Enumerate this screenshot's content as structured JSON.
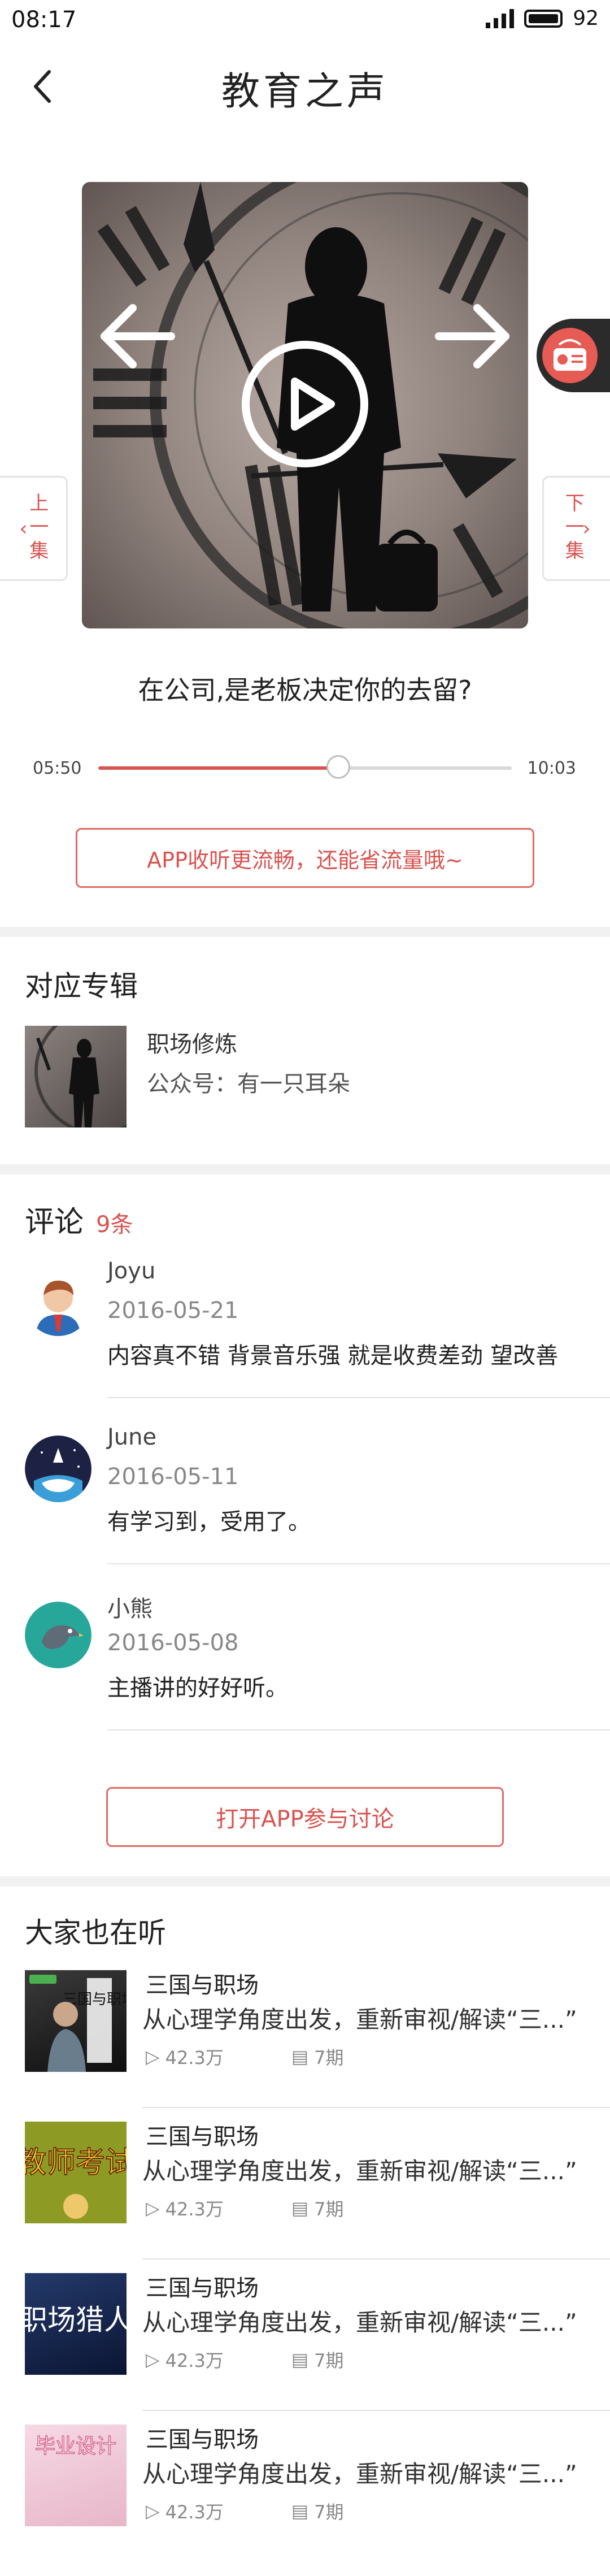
{
  "status_bar": {
    "time": "08:17",
    "battery": "92"
  },
  "nav": {
    "title": "教育之声"
  },
  "player": {
    "prev_label": "上一集",
    "next_label": "下一集",
    "track_title": "在公司,是老板决定你的去留?",
    "current_time": "05:50",
    "total_time": "10:03",
    "progress": 0.58,
    "app_prompt": "APP收听更流畅，还能省流量哦~"
  },
  "album": {
    "section_title": "对应专辑",
    "name": "职场修炼",
    "account": "公众号：有一只耳朵"
  },
  "comments": {
    "section_title": "评论",
    "count": "9条",
    "items": [
      {
        "user": "Joyu",
        "date": "2016-05-21",
        "text": "内容真不错 背景音乐强 就是收费差劲 望改善"
      },
      {
        "user": "June",
        "date": "2016-05-11",
        "text": "有学习到，受用了。"
      },
      {
        "user": "小熊",
        "date": "2016-05-08",
        "text": "主播讲的好好听。"
      }
    ],
    "discuss_button": "打开APP参与讨论"
  },
  "also_listening": {
    "section_title": "大家也在听",
    "items": [
      {
        "name": "三国与职场",
        "desc": "从心理学角度出发，重新审视/解读“三...”",
        "plays": "42.3万",
        "episodes": "7期"
      },
      {
        "name": "三国与职场",
        "desc": "从心理学角度出发，重新审视/解读“三...”",
        "plays": "42.3万",
        "episodes": "7期"
      },
      {
        "name": "三国与职场",
        "desc": "从心理学角度出发，重新审视/解读“三...”",
        "plays": "42.3万",
        "episodes": "7期"
      },
      {
        "name": "三国与职场",
        "desc": "从心理学角度出发，重新审视/解读“三...”",
        "plays": "42.3万",
        "episodes": "7期"
      }
    ],
    "thumb_texts": [
      "三国与职场",
      "教师考试",
      "职场猎人",
      "毕业设计"
    ]
  }
}
